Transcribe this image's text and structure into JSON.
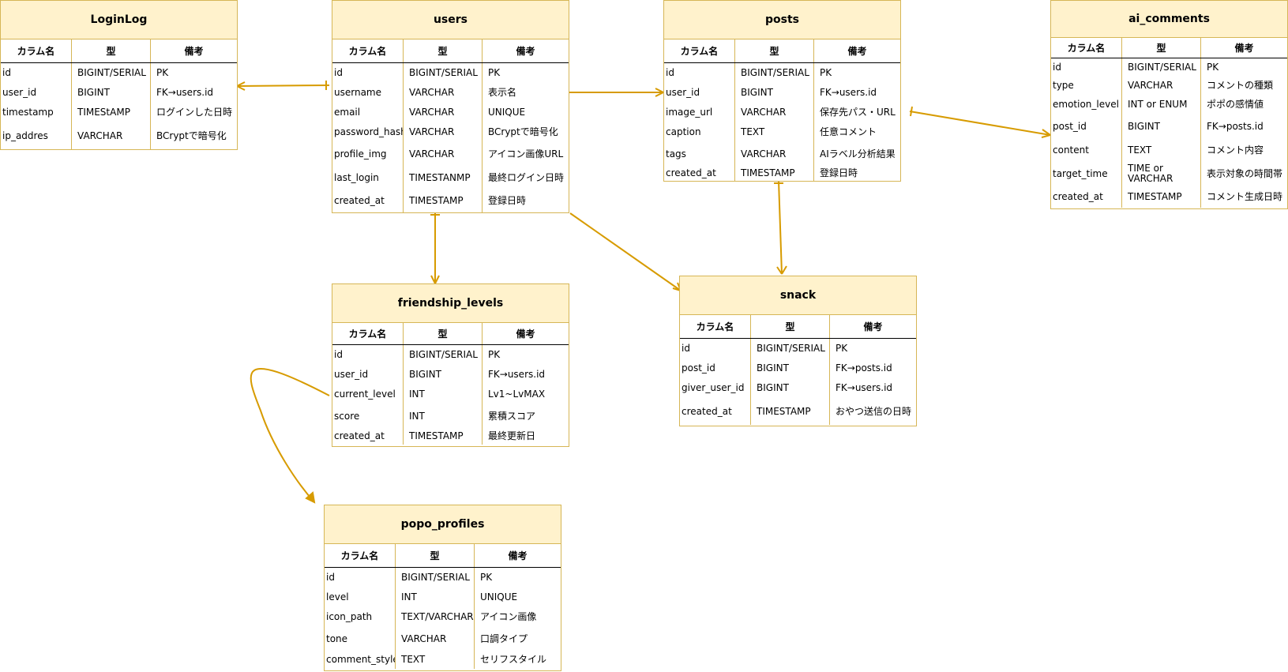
{
  "header_labels": {
    "name": "カラム名",
    "type": "型",
    "note": "備考"
  },
  "tables": {
    "loginlog": {
      "title": "LoginLog",
      "rows": [
        [
          "id",
          "BIGINT/SERIAL",
          "PK"
        ],
        [
          "user_id",
          "BIGINT",
          "FK→users.id"
        ],
        [
          "timestamp",
          "TIMEStAMP",
          "ログインした日時"
        ],
        [
          "ip_addres",
          "VARCHAR",
          "BCryptで暗号化"
        ]
      ]
    },
    "users": {
      "title": "users",
      "rows": [
        [
          "id",
          "BIGINT/SERIAL",
          "PK"
        ],
        [
          "username",
          "VARCHAR",
          "表示名"
        ],
        [
          "email",
          "VARCHAR",
          "UNIQUE"
        ],
        [
          "password_hash",
          "VARCHAR",
          "BCryptで暗号化"
        ],
        [
          "profile_img",
          "VARCHAR",
          "アイコン画像URL"
        ],
        [
          "last_login",
          "TIMESTANMP",
          "最終ログイン日時"
        ],
        [
          "created_at",
          "TIMESTAMP",
          "登録日時"
        ]
      ]
    },
    "posts": {
      "title": "posts",
      "rows": [
        [
          "id",
          "BIGINT/SERIAL",
          "PK"
        ],
        [
          "user_id",
          "BIGINT",
          "FK→users.id"
        ],
        [
          "image_url",
          "VARCHAR",
          "保存先パス・URL"
        ],
        [
          "caption",
          "TEXT",
          "任意コメント"
        ],
        [
          "tags",
          "VARCHAR",
          "AIラベル分析結果"
        ],
        [
          "created_at",
          "TIMESTAMP",
          "登録日時"
        ]
      ]
    },
    "ai_comments": {
      "title": "ai_comments",
      "rows": [
        [
          "id",
          "BIGINT/SERIAL",
          "PK"
        ],
        [
          "type",
          "VARCHAR",
          "コメントの種類"
        ],
        [
          "emotion_level",
          "INT or ENUM",
          "ポポの感情値"
        ],
        [
          "post_id",
          "BIGINT",
          "FK→posts.id"
        ],
        [
          "content",
          "TEXT",
          "コメント内容"
        ],
        [
          "target_time",
          "TIME or\nVARCHAR",
          "表示対象の時間帯"
        ],
        [
          "created_at",
          "TIMESTAMP",
          "コメント生成日時"
        ]
      ]
    },
    "friendship_levels": {
      "title": "friendship_levels",
      "rows": [
        [
          "id",
          "BIGINT/SERIAL",
          "PK"
        ],
        [
          "user_id",
          "BIGINT",
          "FK→users.id"
        ],
        [
          "current_level",
          "INT",
          "Lv1~LvMAX"
        ],
        [
          "score",
          "INT",
          "累積スコア"
        ],
        [
          "created_at",
          "TIMESTAMP",
          "最終更新日"
        ]
      ]
    },
    "snack": {
      "title": "snack",
      "rows": [
        [
          "id",
          "BIGINT/SERIAL",
          "PK"
        ],
        [
          "post_id",
          "BIGINT",
          "FK→posts.id"
        ],
        [
          "giver_user_id",
          "BIGINT",
          "FK→users.id"
        ],
        [
          "created_at",
          "TIMESTAMP",
          "おやつ送信の日時"
        ]
      ]
    },
    "popo_profiles": {
      "title": "popo_profiles",
      "rows": [
        [
          "id",
          "BIGINT/SERIAL",
          "PK"
        ],
        [
          "level",
          "INT",
          "UNIQUE"
        ],
        [
          "icon_path",
          "TEXT/VARCHAR",
          "アイコン画像"
        ],
        [
          "tone",
          "VARCHAR",
          "口調タイプ"
        ],
        [
          "comment_style",
          "TEXT",
          "セリフスタイル"
        ]
      ]
    }
  },
  "colors": {
    "header_fill": "#fff2cc",
    "border": "#d6b656",
    "edge": "#d79b00"
  }
}
